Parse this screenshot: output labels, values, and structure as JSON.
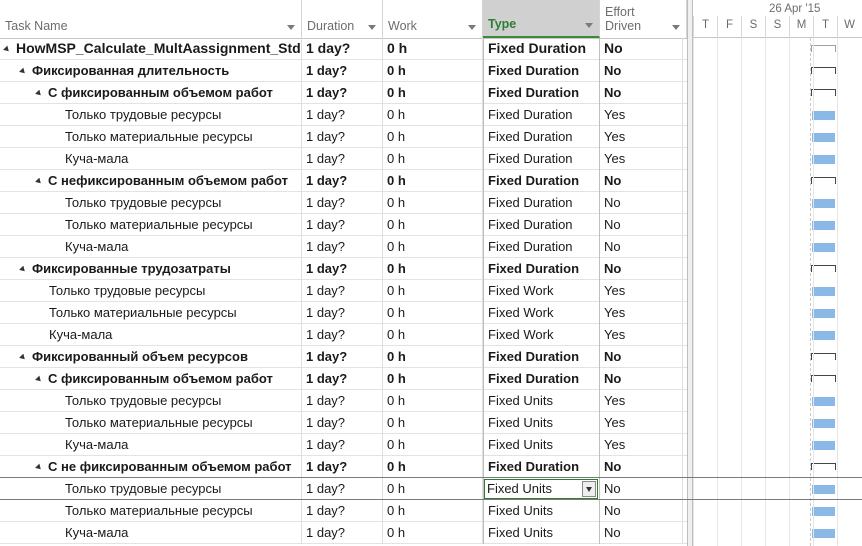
{
  "columns": {
    "name": "Task Name",
    "duration": "Duration",
    "work": "Work",
    "type": "Type",
    "effort_line1": "Effort",
    "effort_line2": "Driven"
  },
  "timescale": {
    "week_label": "26 Apr '15",
    "days": [
      "T",
      "F",
      "S",
      "S",
      "M",
      "T",
      "W"
    ]
  },
  "bar_color": "#8ab9e8",
  "tasks": [
    {
      "name": "HowMSP_Calculate_MultAassignment_Std",
      "duration": "1 day?",
      "work": "0 h",
      "type": "Fixed Duration",
      "effort_driven": "No",
      "level": 0,
      "summary": true
    },
    {
      "name": "Фиксированная длительность",
      "duration": "1 day?",
      "work": "0 h",
      "type": "Fixed Duration",
      "effort_driven": "No",
      "level": 1,
      "summary": true
    },
    {
      "name": "С фиксированным объемом работ",
      "duration": "1 day?",
      "work": "0 h",
      "type": "Fixed Duration",
      "effort_driven": "No",
      "level": 2,
      "summary": true
    },
    {
      "name": "Только трудовые ресурсы",
      "duration": "1 day?",
      "work": "0 h",
      "type": "Fixed Duration",
      "effort_driven": "Yes",
      "level": 3,
      "summary": false
    },
    {
      "name": "Только материальные ресурсы",
      "duration": "1 day?",
      "work": "0 h",
      "type": "Fixed Duration",
      "effort_driven": "Yes",
      "level": 3,
      "summary": false
    },
    {
      "name": "Куча-мала",
      "duration": "1 day?",
      "work": "0 h",
      "type": "Fixed Duration",
      "effort_driven": "Yes",
      "level": 3,
      "summary": false
    },
    {
      "name": "С нефиксированным объемом работ",
      "duration": "1 day?",
      "work": "0 h",
      "type": "Fixed Duration",
      "effort_driven": "No",
      "level": 2,
      "summary": true
    },
    {
      "name": "Только трудовые ресурсы",
      "duration": "1 day?",
      "work": "0 h",
      "type": "Fixed Duration",
      "effort_driven": "No",
      "level": 3,
      "summary": false
    },
    {
      "name": "Только материальные ресурсы",
      "duration": "1 day?",
      "work": "0 h",
      "type": "Fixed Duration",
      "effort_driven": "No",
      "level": 3,
      "summary": false
    },
    {
      "name": "Куча-мала",
      "duration": "1 day?",
      "work": "0 h",
      "type": "Fixed Duration",
      "effort_driven": "No",
      "level": 3,
      "summary": false
    },
    {
      "name": "Фиксированные трудозатраты",
      "duration": "1 day?",
      "work": "0 h",
      "type": "Fixed Duration",
      "effort_driven": "No",
      "level": 1,
      "summary": true
    },
    {
      "name": "Только трудовые ресурсы",
      "duration": "1 day?",
      "work": "0 h",
      "type": "Fixed Work",
      "effort_driven": "Yes",
      "level": 2,
      "summary": false
    },
    {
      "name": "Только материальные ресурсы",
      "duration": "1 day?",
      "work": "0 h",
      "type": "Fixed Work",
      "effort_driven": "Yes",
      "level": 2,
      "summary": false
    },
    {
      "name": "Куча-мала",
      "duration": "1 day?",
      "work": "0 h",
      "type": "Fixed Work",
      "effort_driven": "Yes",
      "level": 2,
      "summary": false
    },
    {
      "name": "Фиксированный объем ресурсов",
      "duration": "1 day?",
      "work": "0 h",
      "type": "Fixed Duration",
      "effort_driven": "No",
      "level": 1,
      "summary": true
    },
    {
      "name": "С фиксированным объемом работ",
      "duration": "1 day?",
      "work": "0 h",
      "type": "Fixed Duration",
      "effort_driven": "No",
      "level": 2,
      "summary": true
    },
    {
      "name": "Только трудовые ресурсы",
      "duration": "1 day?",
      "work": "0 h",
      "type": "Fixed Units",
      "effort_driven": "Yes",
      "level": 3,
      "summary": false
    },
    {
      "name": "Только материальные ресурсы",
      "duration": "1 day?",
      "work": "0 h",
      "type": "Fixed Units",
      "effort_driven": "Yes",
      "level": 3,
      "summary": false
    },
    {
      "name": "Куча-мала",
      "duration": "1 day?",
      "work": "0 h",
      "type": "Fixed Units",
      "effort_driven": "Yes",
      "level": 3,
      "summary": false
    },
    {
      "name": "С не фиксированным объемом работ",
      "duration": "1 day?",
      "work": "0 h",
      "type": "Fixed Duration",
      "effort_driven": "No",
      "level": 2,
      "summary": true
    },
    {
      "name": "Только трудовые ресурсы",
      "duration": "1 day?",
      "work": "0 h",
      "type": "Fixed Units",
      "effort_driven": "No",
      "level": 3,
      "summary": false,
      "selected": true
    },
    {
      "name": "Только материальные ресурсы",
      "duration": "1 day?",
      "work": "0 h",
      "type": "Fixed Units",
      "effort_driven": "No",
      "level": 3,
      "summary": false
    },
    {
      "name": "Куча-мала",
      "duration": "1 day?",
      "work": "0 h",
      "type": "Fixed Units",
      "effort_driven": "No",
      "level": 3,
      "summary": false
    }
  ]
}
